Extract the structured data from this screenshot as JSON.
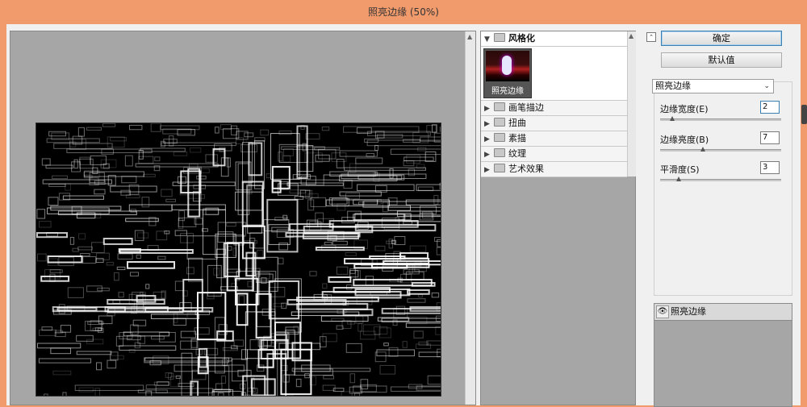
{
  "window": {
    "title": "照亮边缘 (50%)"
  },
  "gallery": {
    "categories": [
      {
        "label": "风格化",
        "expanded": true
      },
      {
        "label": "画笔描边",
        "expanded": false
      },
      {
        "label": "扭曲",
        "expanded": false
      },
      {
        "label": "素描",
        "expanded": false
      },
      {
        "label": "纹理",
        "expanded": false
      },
      {
        "label": "艺术效果",
        "expanded": false
      }
    ],
    "selected_thumb": {
      "label": "照亮边缘"
    }
  },
  "settings": {
    "ok_label": "确定",
    "default_label": "默认值",
    "filter_select": "照亮边缘",
    "params": [
      {
        "label": "边缘宽度(E)",
        "value": "2",
        "fraction": 0.1
      },
      {
        "label": "边缘亮度(B)",
        "value": "7",
        "fraction": 0.35
      },
      {
        "label": "平滑度(S)",
        "value": "3",
        "fraction": 0.15
      }
    ]
  },
  "layers": {
    "items": [
      {
        "name": "照亮边缘",
        "visible": true
      }
    ]
  },
  "icons": {
    "collapse": "double-chevron-up-icon",
    "triangle": "disclosure-triangle-icon",
    "folder": "folder-icon",
    "eye": "eye-icon"
  },
  "colors": {
    "titlebar": "#f19a6c",
    "panel": "#f0f0f0",
    "workspace": "#a6a6a6"
  }
}
